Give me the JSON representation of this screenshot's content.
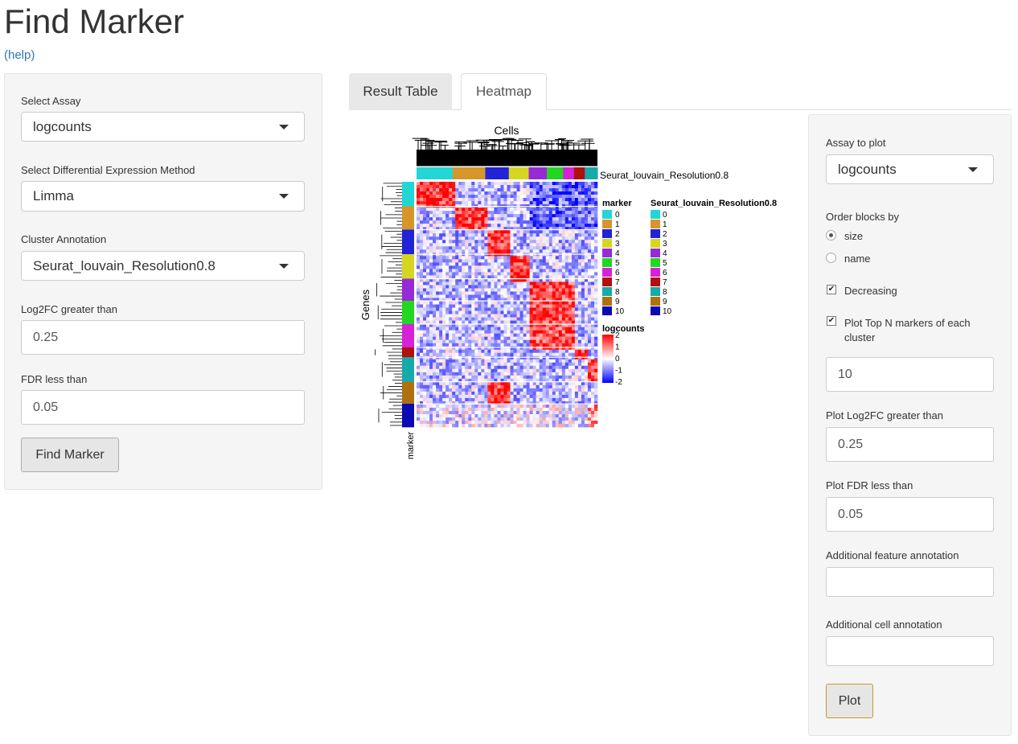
{
  "page": {
    "title": "Find Marker",
    "help_link": "(help)"
  },
  "left_panel": {
    "assay_label": "Select Assay",
    "assay_value": "logcounts",
    "method_label": "Select Differential Expression Method",
    "method_value": "Limma",
    "cluster_label": "Cluster Annotation",
    "cluster_value": "Seurat_louvain_Resolution0.8",
    "log2fc_label": "Log2FC greater than",
    "log2fc_value": "0.25",
    "fdr_label": "FDR less than",
    "fdr_value": "0.05",
    "find_button": "Find Marker"
  },
  "tabs": [
    {
      "label": "Result Table",
      "active": false
    },
    {
      "label": "Heatmap",
      "active": true
    }
  ],
  "heatmap": {
    "top_title": "Cells",
    "row_title": "Genes",
    "row_anno_label": "marker",
    "col_anno_label": "Seurat_louvain_Resolution0.8",
    "legend_marker_title": "marker",
    "legend_cluster_title": "Seurat_louvain_Resolution0.8",
    "legend_expr_title": "logcounts",
    "legend_expr_ticks": [
      "2",
      "1",
      "0",
      "-1",
      "-2"
    ],
    "clusters": [
      {
        "id": "0",
        "color": "#22d6d6"
      },
      {
        "id": "1",
        "color": "#d6962a"
      },
      {
        "id": "2",
        "color": "#2222d6"
      },
      {
        "id": "3",
        "color": "#d6d622"
      },
      {
        "id": "4",
        "color": "#962ad6"
      },
      {
        "id": "5",
        "color": "#22d622"
      },
      {
        "id": "6",
        "color": "#d622d6"
      },
      {
        "id": "7",
        "color": "#b01010"
      },
      {
        "id": "8",
        "color": "#16aaaa"
      },
      {
        "id": "9",
        "color": "#b07010"
      },
      {
        "id": "10",
        "color": "#0a0ab0"
      }
    ]
  },
  "right_panel": {
    "assay_label": "Assay to plot",
    "assay_value": "logcounts",
    "order_label": "Order blocks by",
    "order_options": [
      "size",
      "name"
    ],
    "order_selected": "size",
    "decreasing_label": "Decreasing",
    "decreasing_checked": true,
    "topn_label": "Plot Top N markers of each cluster",
    "topn_checked": true,
    "topn_value": "10",
    "log2fc_label": "Plot Log2FC greater than",
    "log2fc_value": "0.25",
    "fdr_label": "Plot FDR less than",
    "fdr_value": "0.05",
    "feature_anno_label": "Additional feature annotation",
    "feature_anno_value": "",
    "cell_anno_label": "Additional cell annotation",
    "cell_anno_value": "",
    "plot_button": "Plot"
  }
}
